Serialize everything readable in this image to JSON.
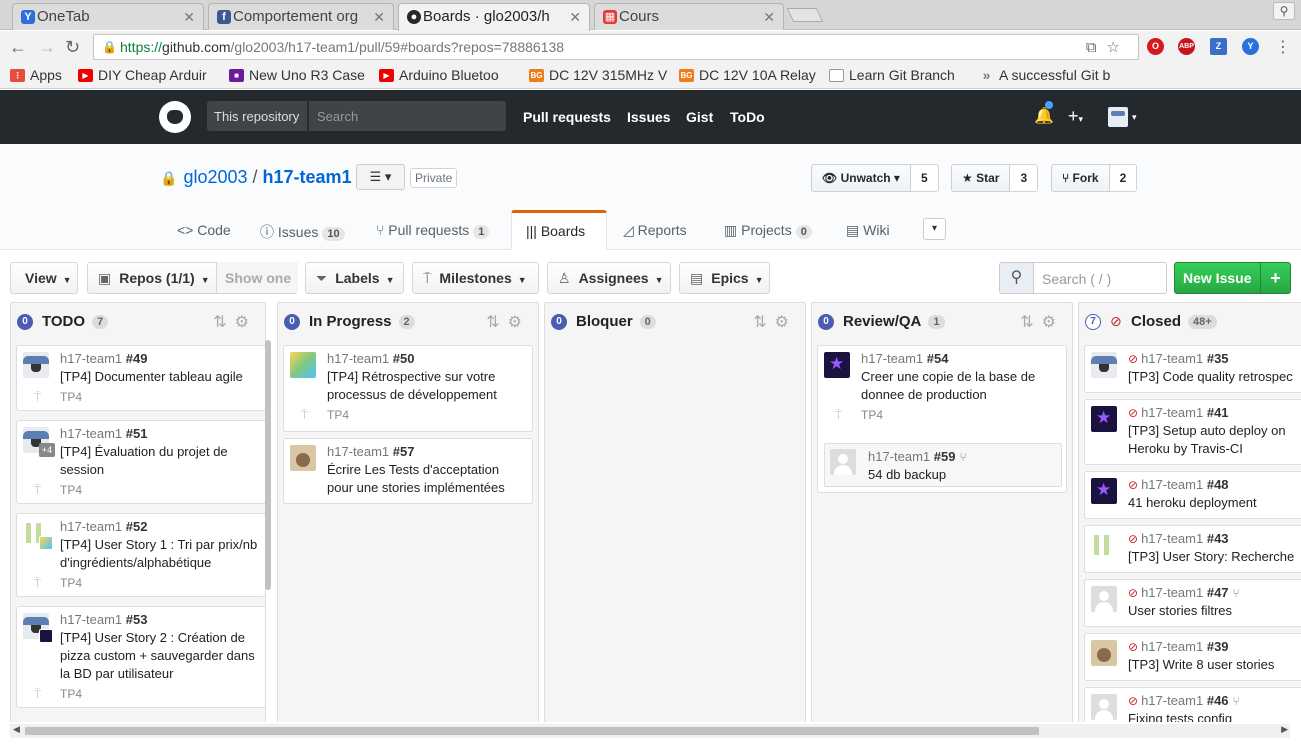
{
  "browser": {
    "tabs": [
      {
        "label": "OneTab",
        "icon": "onetab-icon",
        "color": "#2a6fdb",
        "glyph": "Y"
      },
      {
        "label": "Comportement org",
        "icon": "facebook-icon",
        "color": "#3b5998",
        "glyph": "f"
      },
      {
        "label": "Boards · glo2003/h",
        "icon": "github-icon",
        "color": "#24292e",
        "glyph": "●"
      },
      {
        "label": "Cours",
        "icon": "cours-icon",
        "color": "#e53935",
        "glyph": "▦"
      }
    ],
    "url_https": "https://",
    "url_host": "github.com",
    "url_path": "/glo2003/h17-team1/pull/59#boards?repos=78886138",
    "extensions": [
      {
        "name": "opera-icon",
        "glyph": "O",
        "color": "#d8181f"
      },
      {
        "name": "adblock-icon",
        "glyph": "ABP",
        "color": "#c4161c"
      },
      {
        "name": "zotero-icon",
        "glyph": "Z",
        "color": "#3b6ec6"
      },
      {
        "name": "vpn-icon",
        "glyph": "Y",
        "color": "#2a6fdb"
      }
    ],
    "bookmarks": [
      {
        "label": "Apps",
        "icon": "apps-icon",
        "color": "#e74c3c",
        "glyph": "⋮"
      },
      {
        "label": "DIY Cheap Arduir",
        "icon": "youtube-icon",
        "color": "#e00",
        "glyph": "▶"
      },
      {
        "label": "New Uno R3 Case",
        "icon": "shop-icon",
        "color": "#6a1b9a",
        "glyph": "■"
      },
      {
        "label": "Arduino Bluetoo",
        "icon": "youtube-icon",
        "color": "#e00",
        "glyph": "▶"
      },
      {
        "label": "DC 12V 315MHz V",
        "icon": "banggood-icon",
        "color": "#f07c17",
        "glyph": "BG"
      },
      {
        "label": "DC 12V 10A Relay",
        "icon": "banggood-icon",
        "color": "#f07c17",
        "glyph": "BG"
      },
      {
        "label": "Learn Git Branch",
        "icon": "page-icon",
        "color": "#999",
        "glyph": "▫"
      },
      {
        "label": "A successful Git b",
        "icon": "git-icon",
        "color": "#888",
        "glyph": "»"
      }
    ]
  },
  "github": {
    "scope": "This repository",
    "search_placeholder": "Search",
    "nav": [
      "Pull requests",
      "Issues",
      "Gist",
      "ToDo"
    ],
    "owner": "glo2003",
    "repo": "h17-team1",
    "private_label": "Private",
    "unwatch_label": "Unwatch",
    "unwatch_count": "5",
    "star_label": "Star",
    "star_count": "3",
    "fork_label": "Fork",
    "fork_count": "2",
    "tabs": [
      {
        "label": "Code",
        "count": ""
      },
      {
        "label": "Issues",
        "count": "10"
      },
      {
        "label": "Pull requests",
        "count": "1"
      },
      {
        "label": "Boards",
        "count": ""
      },
      {
        "label": "Reports",
        "count": ""
      },
      {
        "label": "Projects",
        "count": "0"
      },
      {
        "label": "Wiki",
        "count": ""
      }
    ]
  },
  "toolbar": {
    "view": "View",
    "repos": "Repos (1/1)",
    "show_one": "Show one",
    "labels": "Labels",
    "milestones": "Milestones",
    "assignees": "Assignees",
    "epics": "Epics",
    "search_placeholder": "Search ( / )",
    "new_issue": "New Issue",
    "plus": "+"
  },
  "columns": [
    {
      "num": "0",
      "name": "TODO",
      "count": "7"
    },
    {
      "num": "0",
      "name": "In Progress",
      "count": "2"
    },
    {
      "num": "0",
      "name": "Bloquer",
      "count": "0"
    },
    {
      "num": "0",
      "name": "Review/QA",
      "count": "1"
    },
    {
      "num": "7",
      "name": "Closed",
      "count": "48+"
    }
  ],
  "cards": {
    "todo": [
      {
        "repo": "h17-team1",
        "num": "#49",
        "title": "[TP4] Documenter tableau agile",
        "ms": "TP4"
      },
      {
        "repo": "h17-team1",
        "num": "#51",
        "title": "[TP4] Évaluation du projet de session",
        "ms": "TP4",
        "extra": "+4"
      },
      {
        "repo": "h17-team1",
        "num": "#52",
        "title": "[TP4] User Story 1 : Tri par prix/nb d'ingrédients/alphabétique",
        "ms": "TP4"
      },
      {
        "repo": "h17-team1",
        "num": "#53",
        "title": "[TP4] User Story 2 : Création de pizza custom + sauvegarder dans la BD par utilisateur",
        "ms": "TP4"
      }
    ],
    "progress": [
      {
        "repo": "h17-team1",
        "num": "#50",
        "title": "[TP4] Rétrospective sur votre processus de développement",
        "ms": "TP4"
      },
      {
        "repo": "h17-team1",
        "num": "#57",
        "title": "Écrire Les Tests d'acceptation pour une stories implémentées",
        "ms": ""
      }
    ],
    "review": [
      {
        "repo": "h17-team1",
        "num": "#54",
        "title": "Creer une copie de la base de donnee de production",
        "ms": "TP4"
      }
    ],
    "review_pr": {
      "repo": "h17-team1",
      "num": "#59",
      "title": "54 db backup"
    },
    "closed": [
      {
        "repo": "h17-team1",
        "num": "#35",
        "title": "[TP3] Code quality retrospec"
      },
      {
        "repo": "h17-team1",
        "num": "#41",
        "title": "[TP3] Setup auto deploy on Heroku by Travis-CI"
      },
      {
        "repo": "h17-team1",
        "num": "#48",
        "title": "41 heroku deployment"
      },
      {
        "repo": "h17-team1",
        "num": "#43",
        "title": "[TP3] User Story: Recherche"
      },
      {
        "repo": "h17-team1",
        "num": "#47",
        "title": "User stories filtres"
      },
      {
        "repo": "h17-team1",
        "num": "#39",
        "title": "[TP3] Write 8 user stories"
      },
      {
        "repo": "h17-team1",
        "num": "#46",
        "title": "Fixing tests config"
      }
    ]
  }
}
